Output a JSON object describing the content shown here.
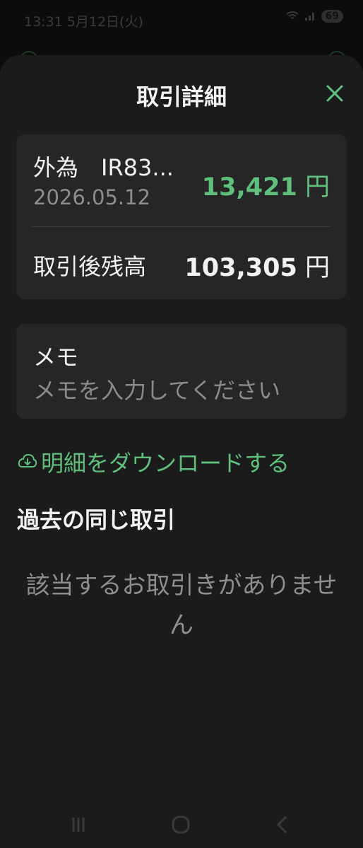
{
  "status": {
    "time": "13:31 5月12日(火)",
    "battery": "69"
  },
  "sheet": {
    "title": "取引詳細"
  },
  "transaction": {
    "name": "外為　IR83...",
    "date": "2026.05.12",
    "amount": "13,421",
    "currency": "円",
    "balance_label": "取引後残高",
    "balance": "103,305",
    "balance_currency": "円"
  },
  "memo": {
    "label": "メモ",
    "value": "",
    "placeholder": "メモを入力してください"
  },
  "download": {
    "label": "明細をダウンロードする"
  },
  "history": {
    "title": "過去の同じ取引",
    "empty_message": "該当するお取引きがありません"
  },
  "colors": {
    "accent": "#5fbf7c",
    "background": "#1b1b1b",
    "card": "#262626"
  },
  "icons": {
    "close": "close-icon",
    "download": "cloud-download-icon",
    "nav_recents": "recents-icon",
    "nav_home": "home-icon",
    "nav_back": "back-icon"
  }
}
